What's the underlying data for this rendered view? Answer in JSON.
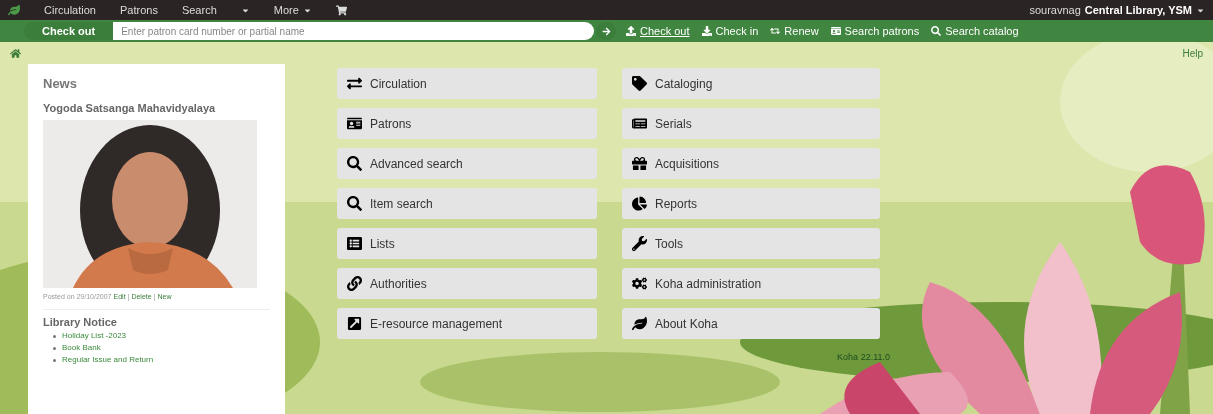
{
  "top_nav": {
    "items": [
      {
        "label": "Circulation",
        "caret": false
      },
      {
        "label": "Patrons",
        "caret": false
      },
      {
        "label": "Search",
        "caret": false
      },
      {
        "caret": true
      },
      {
        "label": "More",
        "caret": true
      }
    ],
    "user": {
      "name": "souravnag",
      "library": "Central Library, YSM"
    }
  },
  "checkout_bar": {
    "tab": "Check out",
    "placeholder": "Enter patron card number or partial name",
    "links": [
      {
        "label": "Check out",
        "selected": true
      },
      {
        "label": "Check in",
        "selected": false
      },
      {
        "label": "Renew",
        "selected": false
      },
      {
        "label": "Search patrons",
        "selected": false
      },
      {
        "label": "Search catalog",
        "selected": false
      }
    ]
  },
  "help": "Help",
  "news": {
    "heading": "News",
    "title": "Yogoda Satsanga Mahavidyalaya",
    "posted": "Posted on 29/10/2007",
    "actions": [
      "Edit",
      "Delete",
      "New"
    ],
    "separator": "|",
    "notice_title": "Library Notice",
    "notices": [
      "Holiday List -2023",
      "Book Bank",
      "Regular Issue and Return"
    ]
  },
  "modules": [
    {
      "label": "Circulation"
    },
    {
      "label": "Cataloging"
    },
    {
      "label": "Patrons"
    },
    {
      "label": "Serials"
    },
    {
      "label": "Advanced search"
    },
    {
      "label": "Acquisitions"
    },
    {
      "label": "Item search"
    },
    {
      "label": "Reports"
    },
    {
      "label": "Lists"
    },
    {
      "label": "Tools"
    },
    {
      "label": "Authorities"
    },
    {
      "label": "Koha administration"
    },
    {
      "label": "E-resource management"
    },
    {
      "label": "About Koha"
    }
  ],
  "version": "Koha 22.11.0"
}
